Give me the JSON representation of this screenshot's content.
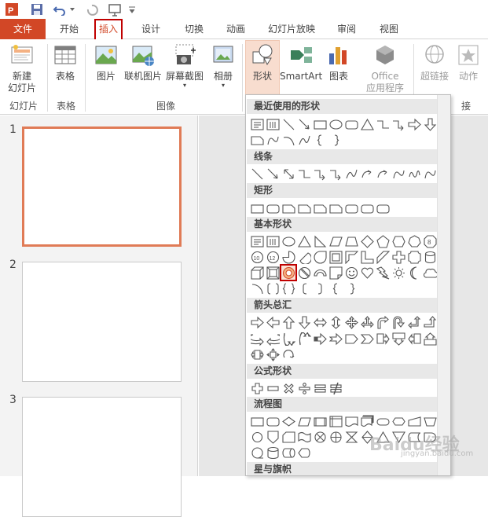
{
  "qat": {
    "icons": [
      "powerpoint-logo-icon",
      "save-icon",
      "undo-icon",
      "redo-icon",
      "start-from-beginning-icon",
      "customize-qat-icon"
    ]
  },
  "tabs": [
    {
      "label": "文件",
      "name": "tab-file"
    },
    {
      "label": "开始",
      "name": "tab-home"
    },
    {
      "label": "插入",
      "name": "tab-insert"
    },
    {
      "label": "设计",
      "name": "tab-design"
    },
    {
      "label": "切换",
      "name": "tab-transitions"
    },
    {
      "label": "动画",
      "name": "tab-animations"
    },
    {
      "label": "幻灯片放映",
      "name": "tab-slideshow"
    },
    {
      "label": "审阅",
      "name": "tab-review"
    },
    {
      "label": "视图",
      "name": "tab-view"
    }
  ],
  "ribbon": {
    "new_slide_line1": "新建",
    "new_slide_line2": "幻灯片",
    "table": "表格",
    "picture": "图片",
    "online_picture": "联机图片",
    "screenshot": "屏幕截图",
    "photo_album": "相册",
    "shapes": "形状",
    "smartart": "SmartArt",
    "chart": "图表",
    "office_line1": "Office",
    "office_line2": "应用程序",
    "hyperlink": "超链接",
    "action": "动作",
    "groups": {
      "slides": "幻灯片",
      "tables": "表格",
      "images": "图像",
      "links_tail": "接"
    }
  },
  "slides": [
    {
      "num": "1"
    },
    {
      "num": "2"
    },
    {
      "num": "3"
    }
  ],
  "gallery": {
    "recent": "最近使用的形状",
    "lines": "线条",
    "rectangles": "矩形",
    "basic": "基本形状",
    "arrows": "箭头总汇",
    "equation": "公式形状",
    "flowchart": "流程图",
    "stars": "星与旗帜"
  },
  "watermark": {
    "main": "Baidu经验",
    "sub": "jingyan.baidu.com"
  },
  "colors": {
    "accent": "#d24726",
    "highlight": "#c00000",
    "shapes_pressed": "#f8ddcf"
  }
}
